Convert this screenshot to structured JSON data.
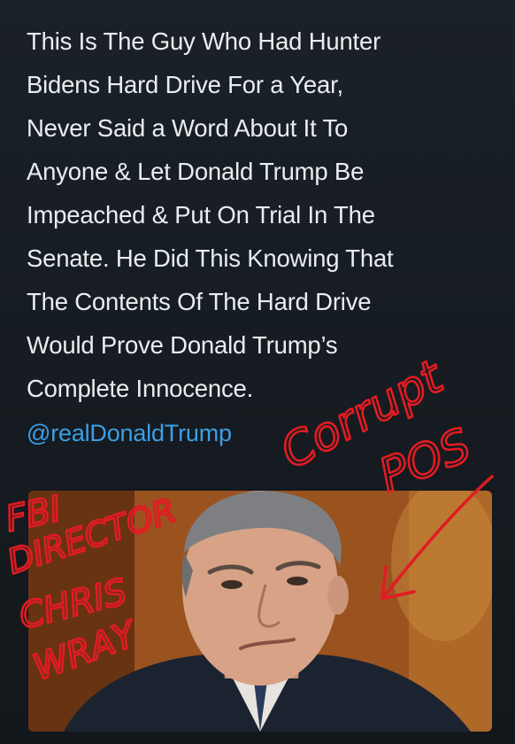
{
  "tweet": {
    "lines": [
      "This Is The Guy Who Had Hunter",
      "Bidens Hard Drive For a Year,",
      "Never Said a Word About It To",
      "Anyone & Let Donald Trump Be",
      "Impeached & Put On Trial In The",
      "Senate. He Did This Knowing That",
      "The Contents Of The Hard Drive",
      "Would Prove Donald Trump’s",
      "Complete Innocence."
    ],
    "handle": "@realDonaldTrump"
  },
  "annotations": {
    "left_lines": [
      "FBI",
      "DIRECTOR",
      "CHRIS",
      "WRAY"
    ],
    "right_lines": [
      "Corrupt",
      "POS"
    ]
  },
  "colors": {
    "background": "#151a1f",
    "text": "#e9edf1",
    "handle": "#3b9fe6",
    "annotation_red": "#e21b22"
  }
}
